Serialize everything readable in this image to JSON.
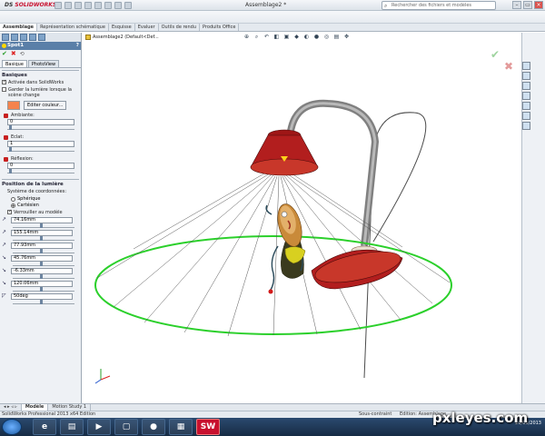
{
  "app": {
    "brand": "SOLIDWORKS",
    "brand_prefix": "DS",
    "doc_title": "Assemblage2 *",
    "search_placeholder": "Rechercher des fichiers et modèles"
  },
  "cm_tabs": [
    "Assemblage",
    "Représentation schématique",
    "Esquisse",
    "Evaluer",
    "Outils de rendu",
    "Produits Office"
  ],
  "breadcrumb": "Assemblage2  (Default<Def...",
  "panel": {
    "title": "Spot1",
    "help": "?",
    "tabs": [
      "Basique",
      "PhotoView"
    ],
    "basiques": {
      "title": "Basiques",
      "check1": "Activée dans SolidWorks",
      "check2": "Garder la lumière lorsque la scène change",
      "edit_color": "Editer couleur...",
      "ambiante_label": "Ambiante:",
      "ambiante_value": "0",
      "eclat_label": "Eclat:",
      "eclat_value": "1",
      "reflexion_label": "Réflexion:",
      "reflexion_value": "0"
    },
    "position": {
      "title": "Position de la lumière",
      "coord_label": "Système de coordonnées:",
      "spherique": "Sphérique",
      "cartesien": "Cartésien",
      "lock": "Verrouiller au modèle",
      "coords": [
        "74.16mm",
        "155.14mm",
        "77.93mm",
        "45.76mm",
        "-6.33mm",
        "120.06mm",
        "50deg"
      ]
    }
  },
  "bottom_tabs": [
    "Modèle",
    "Motion Study 1"
  ],
  "status": {
    "left": "SolidWorks Professional 2013 x64 Edition",
    "mid1": "Sous-contraint",
    "mid2": "Edition: Assemblage"
  },
  "clock": {
    "date": "20/03/2013"
  },
  "watermark": "pxleyes.com",
  "colors": {
    "lamp_red": "#b21e1e",
    "spotlight_green": "#2bd02b",
    "light_color": "#f5834d"
  }
}
